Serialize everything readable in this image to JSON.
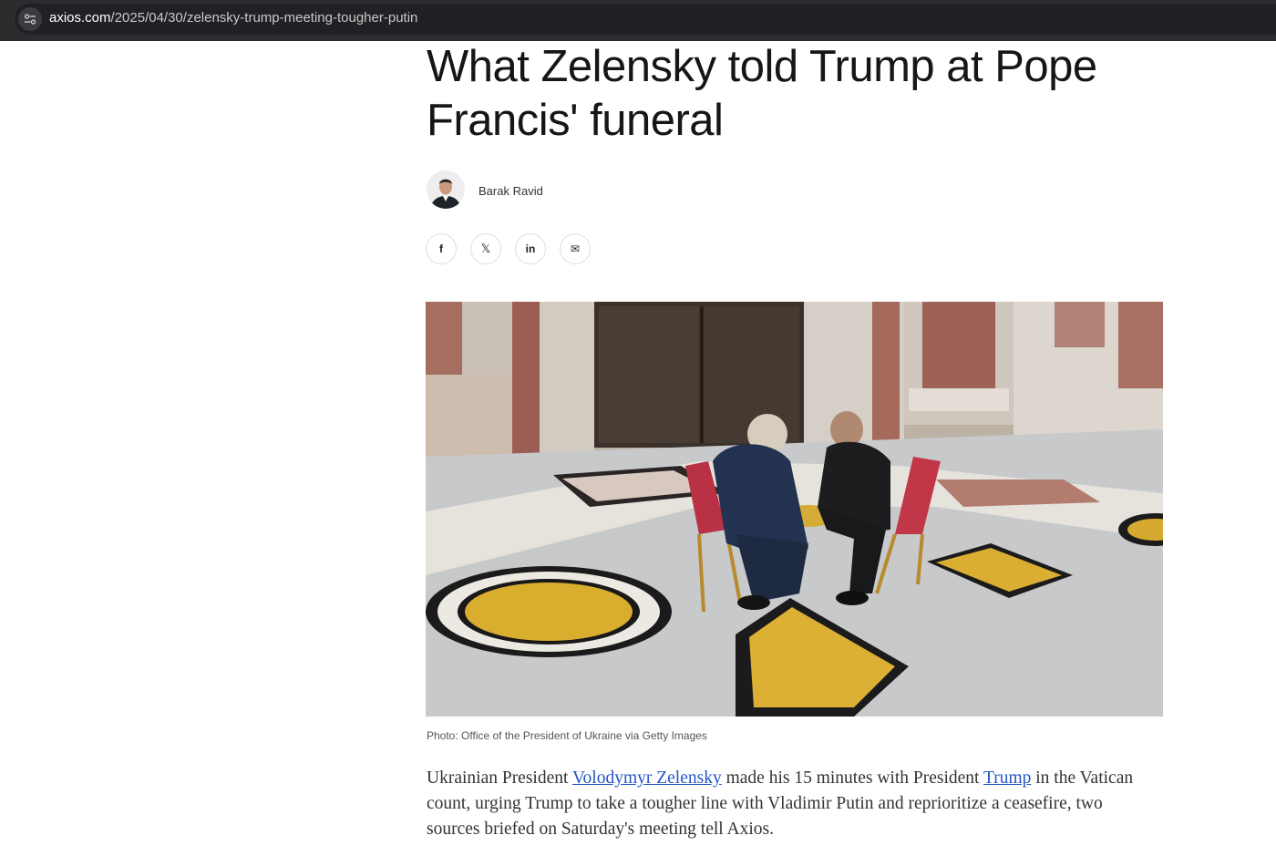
{
  "browser": {
    "url_host": "axios.com",
    "url_path": "/2025/04/30/zelensky-trump-meeting-tougher-putin"
  },
  "article": {
    "headline": "What Zelensky told Trump at Pope Francis' funeral",
    "author": "Barak Ravid",
    "share_buttons": [
      {
        "icon": "facebook-icon",
        "glyph": "f"
      },
      {
        "icon": "x-icon",
        "glyph": "𝕏"
      },
      {
        "icon": "linkedin-icon",
        "glyph": "in"
      },
      {
        "icon": "email-icon",
        "glyph": "✉"
      }
    ],
    "photo_caption": "Photo: Office of the President of Ukraine via Getty Images",
    "body": {
      "t1": "Ukrainian President ",
      "link1": "Volodymyr Zelensky",
      "t2": " made his 15 minutes with President ",
      "link2": "Trump",
      "t3": " in the Vatican count, urging Trump to take a tougher line with Vladimir Putin and reprioritize a ceasefire, two sources briefed on Saturday's meeting tell Axios."
    }
  },
  "colors": {
    "browser_bar": "#2b2c2e",
    "link": "#2554c7",
    "headline": "#161616"
  }
}
